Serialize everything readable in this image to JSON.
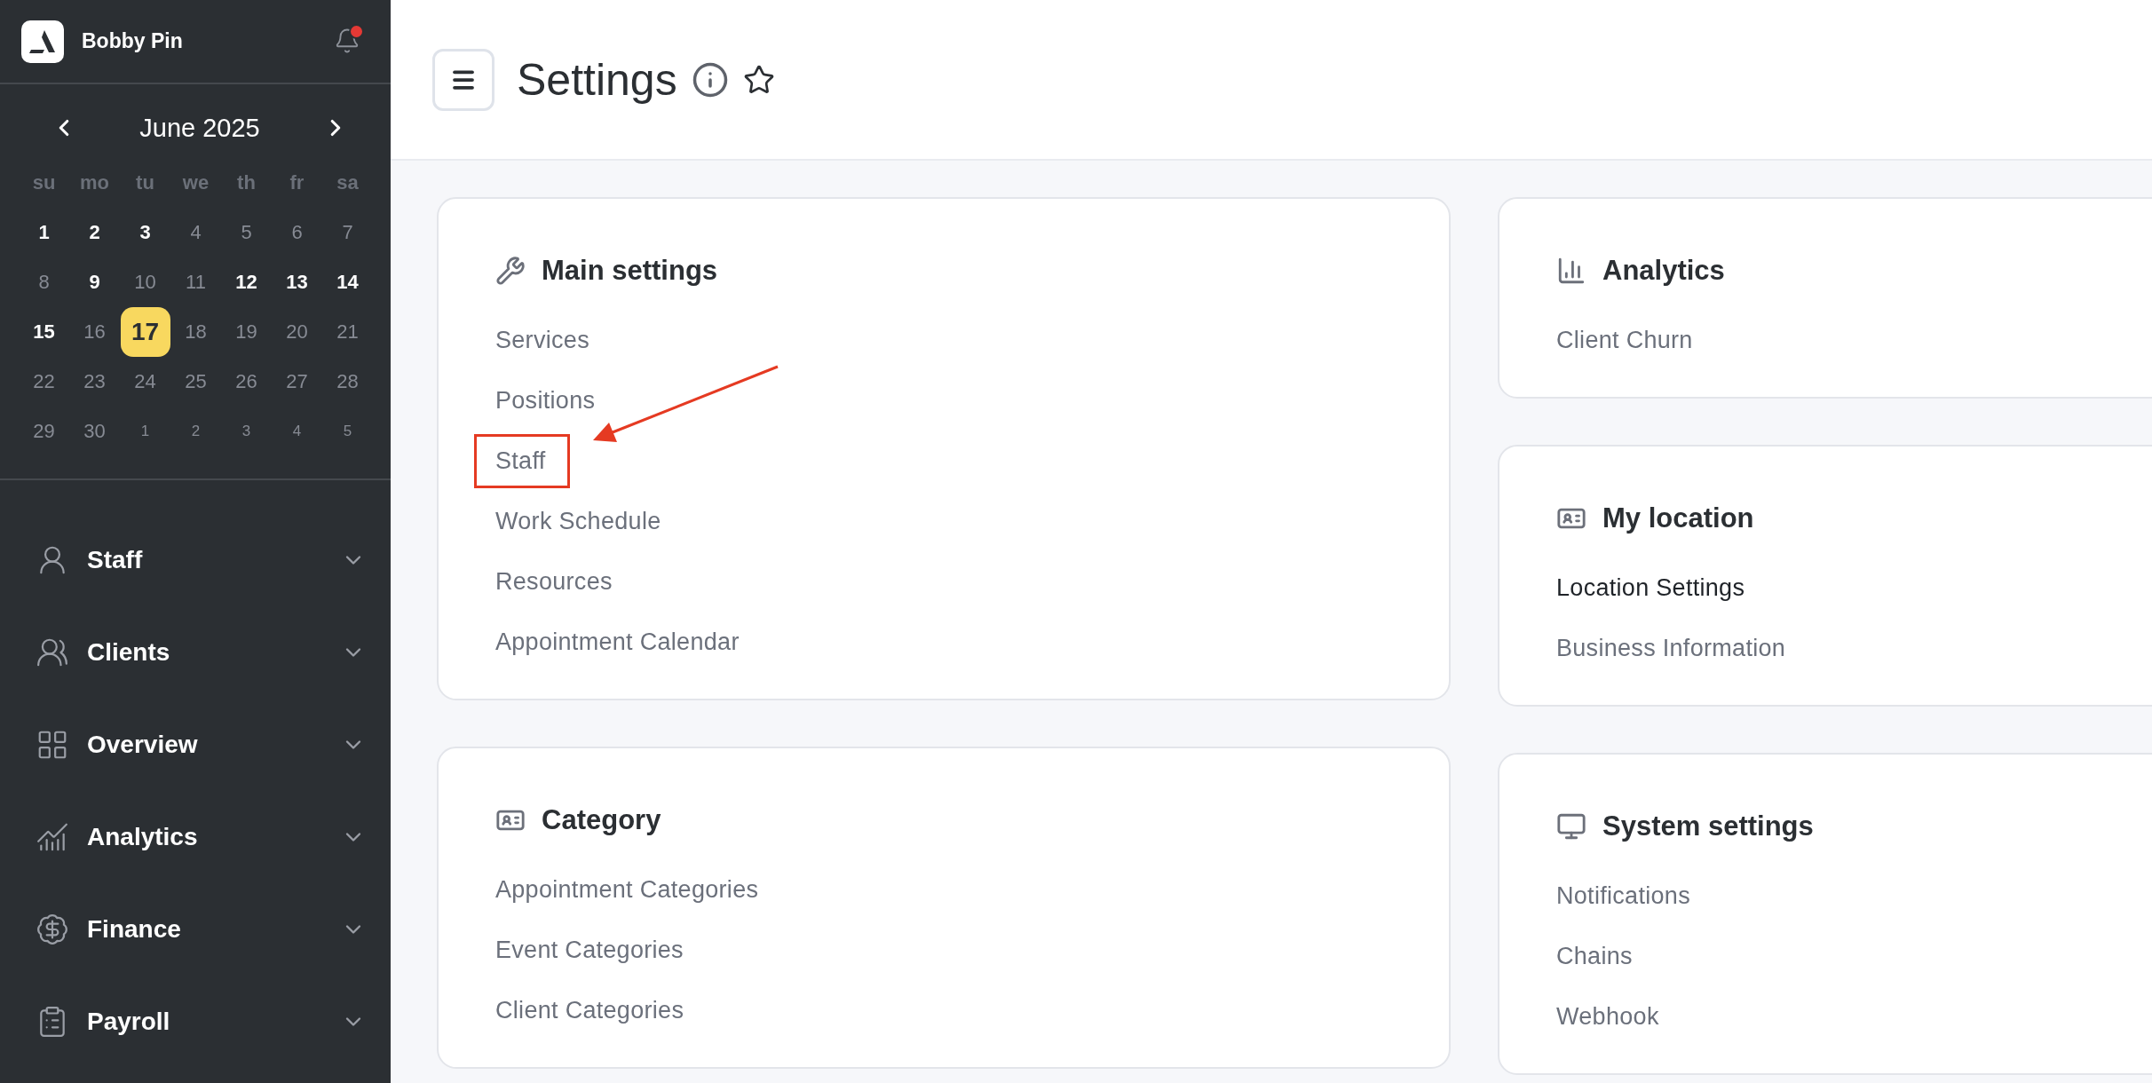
{
  "sidebar": {
    "account": {
      "name": "Bobby Pin",
      "unread_notifications": true
    },
    "calendar": {
      "month": "June 2025",
      "weekdays": [
        "su",
        "mo",
        "tu",
        "we",
        "th",
        "fr",
        "sa"
      ],
      "days": [
        {
          "label": "1",
          "kind": "busy",
          "selected": false
        },
        {
          "label": "2",
          "kind": "busy",
          "selected": false
        },
        {
          "label": "3",
          "kind": "busy",
          "selected": false
        },
        {
          "label": "4",
          "kind": "free",
          "selected": false
        },
        {
          "label": "5",
          "kind": "free",
          "selected": false
        },
        {
          "label": "6",
          "kind": "free",
          "selected": false
        },
        {
          "label": "7",
          "kind": "free",
          "selected": false
        },
        {
          "label": "8",
          "kind": "free",
          "selected": false
        },
        {
          "label": "9",
          "kind": "busy",
          "selected": false
        },
        {
          "label": "10",
          "kind": "free",
          "selected": false
        },
        {
          "label": "11",
          "kind": "free",
          "selected": false
        },
        {
          "label": "12",
          "kind": "busy",
          "selected": false
        },
        {
          "label": "13",
          "kind": "busy",
          "selected": false
        },
        {
          "label": "14",
          "kind": "busy",
          "selected": false
        },
        {
          "label": "15",
          "kind": "busy",
          "selected": false
        },
        {
          "label": "16",
          "kind": "free",
          "selected": false
        },
        {
          "label": "17",
          "kind": "busy",
          "selected": true
        },
        {
          "label": "18",
          "kind": "free",
          "selected": false
        },
        {
          "label": "19",
          "kind": "free",
          "selected": false
        },
        {
          "label": "20",
          "kind": "free",
          "selected": false
        },
        {
          "label": "21",
          "kind": "free",
          "selected": false
        },
        {
          "label": "22",
          "kind": "free",
          "selected": false
        },
        {
          "label": "23",
          "kind": "free",
          "selected": false
        },
        {
          "label": "24",
          "kind": "free",
          "selected": false
        },
        {
          "label": "25",
          "kind": "free",
          "selected": false
        },
        {
          "label": "26",
          "kind": "free",
          "selected": false
        },
        {
          "label": "27",
          "kind": "free",
          "selected": false
        },
        {
          "label": "28",
          "kind": "free",
          "selected": false
        },
        {
          "label": "29",
          "kind": "free",
          "selected": false
        },
        {
          "label": "30",
          "kind": "free",
          "selected": false
        },
        {
          "label": "1",
          "kind": "outside",
          "selected": false
        },
        {
          "label": "2",
          "kind": "outside",
          "selected": false
        },
        {
          "label": "3",
          "kind": "outside",
          "selected": false
        },
        {
          "label": "4",
          "kind": "outside",
          "selected": false
        },
        {
          "label": "5",
          "kind": "outside",
          "selected": false
        }
      ]
    },
    "nav": [
      {
        "label": "Staff",
        "expanded": false
      },
      {
        "label": "Clients",
        "expanded": false
      },
      {
        "label": "Overview",
        "expanded": false
      },
      {
        "label": "Analytics",
        "expanded": false
      },
      {
        "label": "Finance",
        "expanded": false
      },
      {
        "label": "Payroll",
        "expanded": false
      }
    ]
  },
  "header": {
    "title": "Settings",
    "favorite": false
  },
  "columns": [
    {
      "cards": [
        {
          "title": "Main settings",
          "items": [
            {
              "label": "Services",
              "active": false,
              "annotated": false
            },
            {
              "label": "Positions",
              "active": false,
              "annotated": false
            },
            {
              "label": "Staff",
              "active": false,
              "annotated": true
            },
            {
              "label": "Work Schedule",
              "active": false,
              "annotated": false
            },
            {
              "label": "Resources",
              "active": false,
              "annotated": false
            },
            {
              "label": "Appointment Calendar",
              "active": false,
              "annotated": false
            }
          ]
        },
        {
          "title": "Category",
          "items": [
            {
              "label": "Appointment Categories",
              "active": false,
              "annotated": false
            },
            {
              "label": "Event Categories",
              "active": false,
              "annotated": false
            },
            {
              "label": "Client Categories",
              "active": false,
              "annotated": false
            }
          ]
        }
      ]
    },
    {
      "cards": [
        {
          "title": "Analytics",
          "items": [
            {
              "label": "Client Churn",
              "active": false,
              "annotated": false
            }
          ]
        },
        {
          "title": "My location",
          "items": [
            {
              "label": "Location Settings",
              "active": true,
              "annotated": false
            },
            {
              "label": "Business Information",
              "active": false,
              "annotated": false
            }
          ]
        },
        {
          "title": "System settings",
          "items": [
            {
              "label": "Notifications",
              "active": false,
              "annotated": false
            },
            {
              "label": "Chains",
              "active": false,
              "annotated": false
            },
            {
              "label": "Webhook",
              "active": false,
              "annotated": false
            }
          ]
        }
      ]
    }
  ]
}
